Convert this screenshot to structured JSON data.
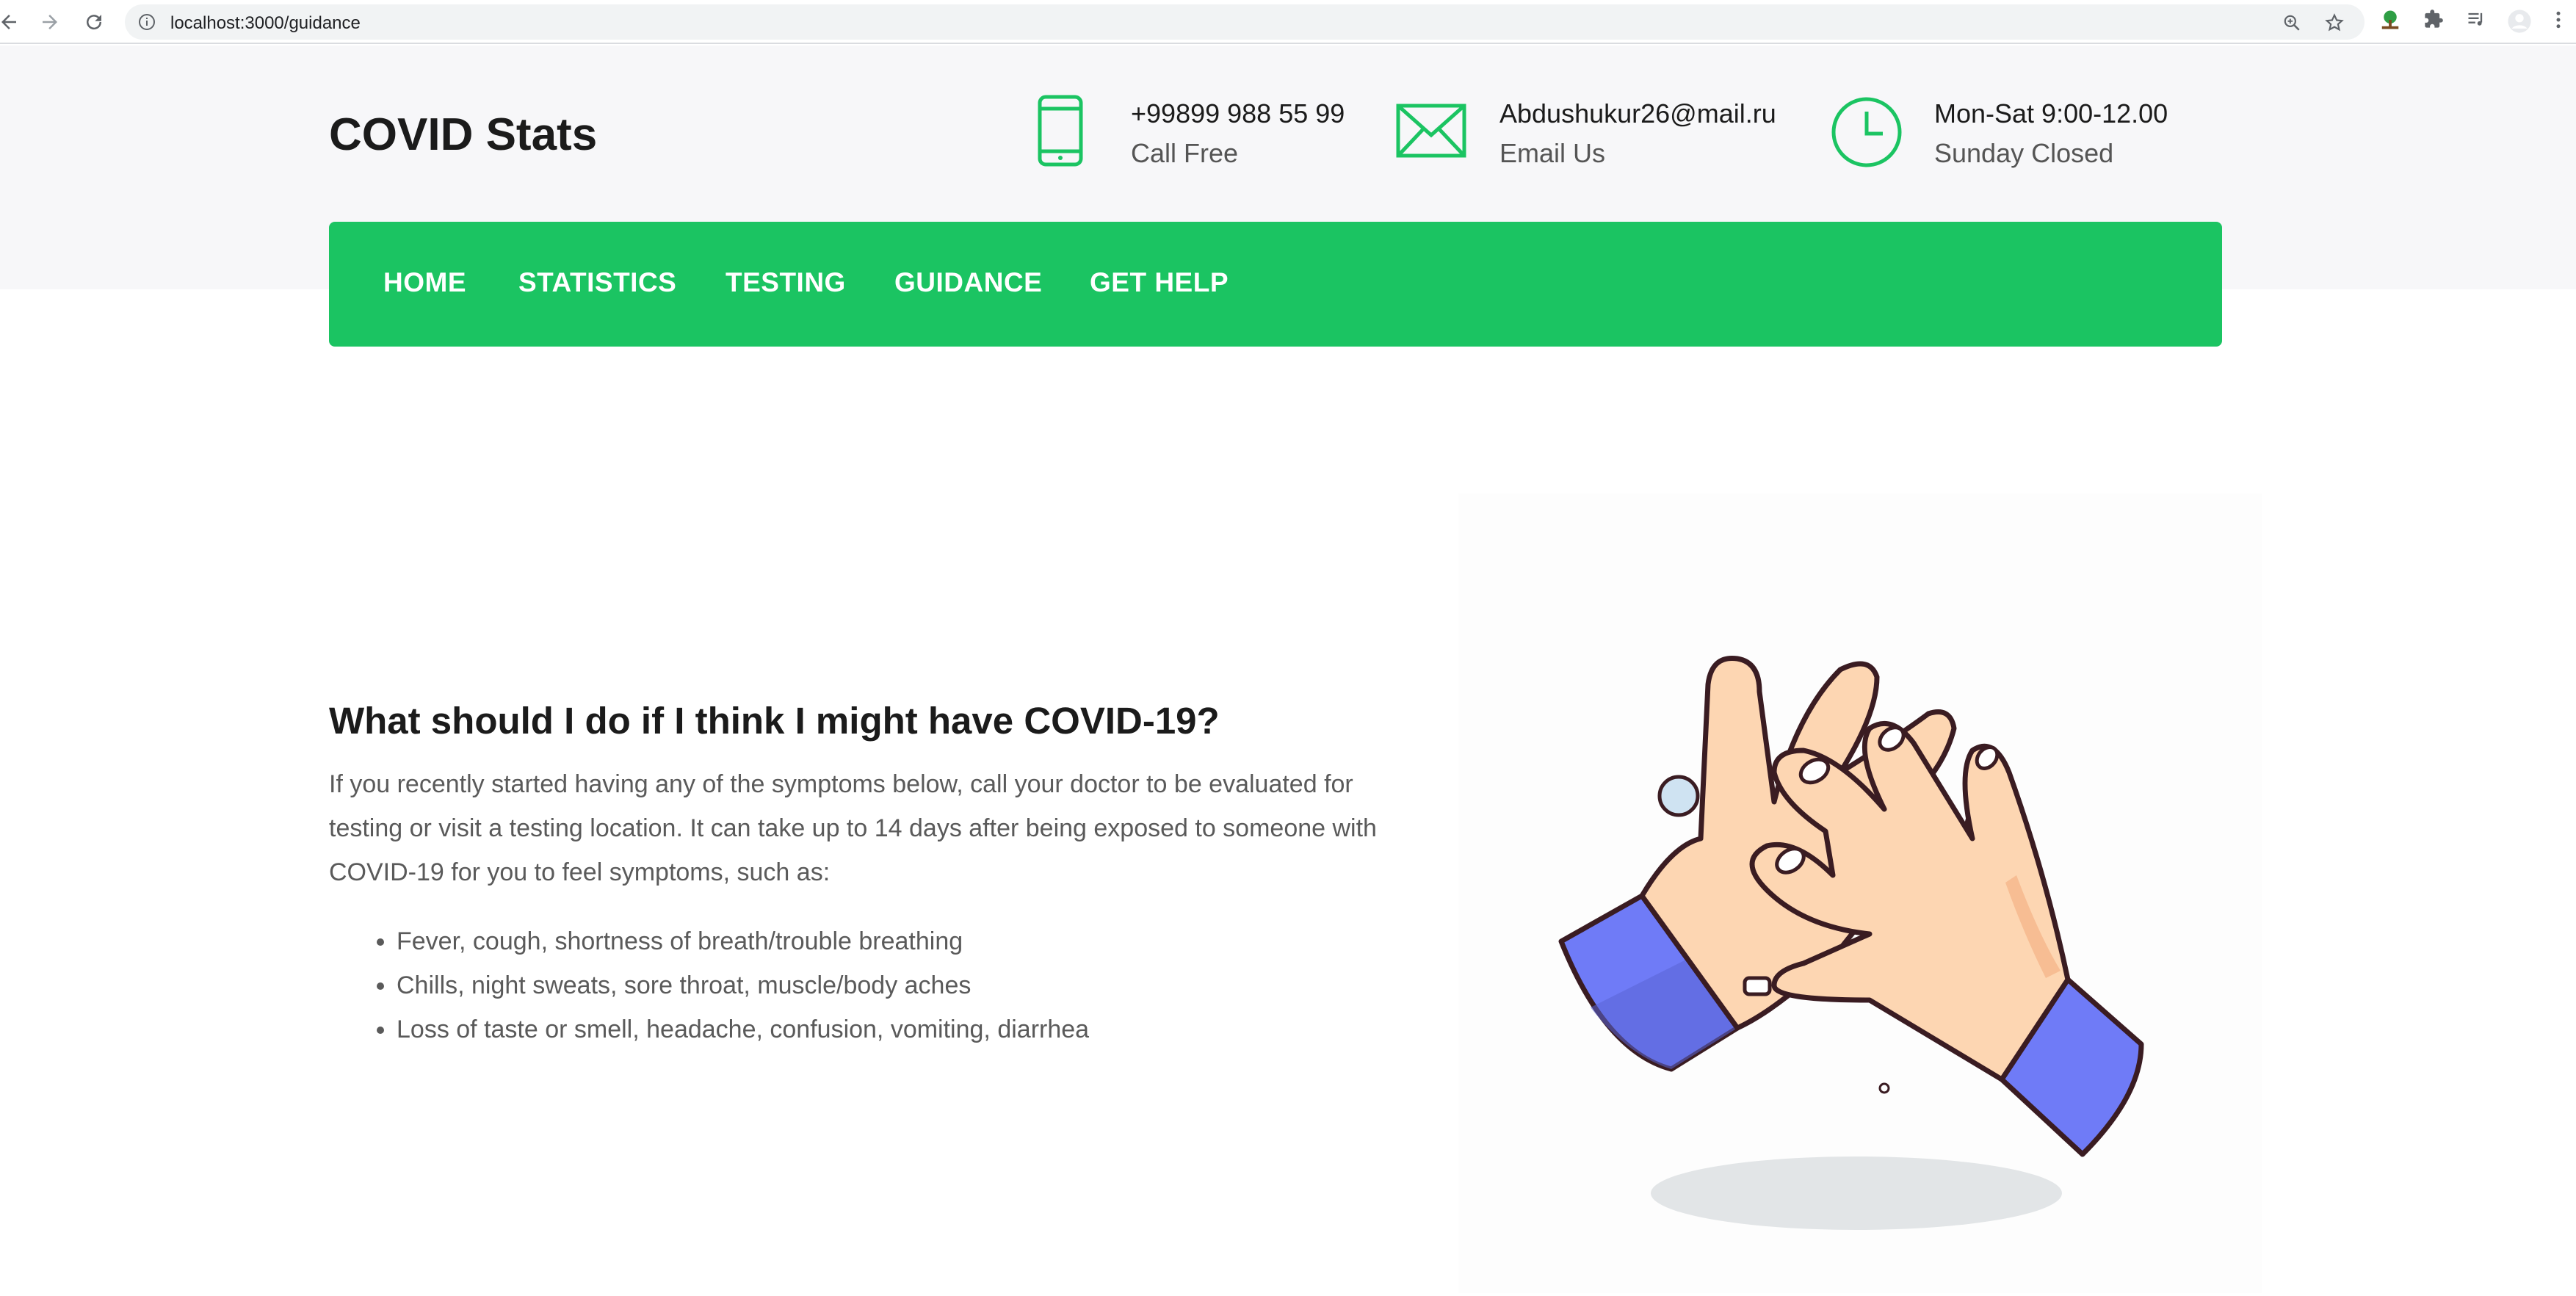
{
  "browser": {
    "url": "localhost:3000/guidance"
  },
  "brand": {
    "title": "COVID Stats"
  },
  "contacts": [
    {
      "icon": "phone-icon",
      "line1": "+99899 988 55 99",
      "line2": "Call Free"
    },
    {
      "icon": "mail-icon",
      "line1": "Abdushukur26@mail.ru",
      "line2": "Email Us"
    },
    {
      "icon": "clock-icon",
      "line1": "Mon-Sat 9:00-12.00",
      "line2": "Sunday Closed"
    }
  ],
  "nav": {
    "items": [
      "HOME",
      "STATISTICS",
      "TESTING",
      "GUIDANCE",
      "GET HELP"
    ]
  },
  "content": {
    "title": "What should I do if I think I might have COVID-19?",
    "body": "If you recently started having any of the symptoms below, call your doctor to be evaluated for testing or visit a testing location. It can take up to 14 days after being exposed to someone with COVID-19 for you to feel symptoms, such as:",
    "symptoms": [
      "Fever, cough, shortness of breath/trouble breathing",
      "Chills, night sweats, sore throat, muscle/body aches",
      "Loss of taste or smell, headache, confusion, vomiting, diarrhea"
    ]
  },
  "colors": {
    "accent": "#1bc462",
    "header_bg": "#f7f7f9",
    "sleeve": "#6f7bf7",
    "skin": "#fdd6b2"
  }
}
